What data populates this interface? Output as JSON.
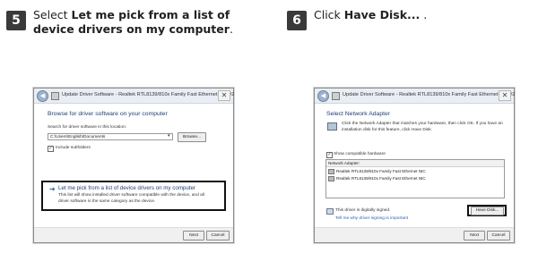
{
  "steps": [
    {
      "number": "5",
      "text_prefix": "Select ",
      "text_bold": "Let me pick from a list of device drivers on my computer",
      "text_suffix": "."
    },
    {
      "number": "6",
      "text_prefix": "Click ",
      "text_bold": "Have Disk...",
      "text_suffix": " ."
    }
  ],
  "dialog1": {
    "title": "Update Driver Software - Realtek RTL8139/810x Family Fast Ethernet NIC #2",
    "heading": "Browse for driver software on your computer",
    "search_label": "Search for driver software in this location:",
    "path_value": "C:\\Users\\English\\Documents",
    "browse_label": "Browse...",
    "include_subfolders": "Include subfolders",
    "option_title": "Let me pick from a list of device drivers on my computer",
    "option_desc_line1": "This list will show installed driver software compatible with the device, and all",
    "option_desc_line2": "driver software in the same category as the device.",
    "next_label": "Next",
    "cancel_label": "Cancel"
  },
  "dialog2": {
    "title": "Update Driver Software - Realtek RTL8139/810x Family Fast Ethernet NIC #2",
    "heading": "Select Network Adapter",
    "instruction_line1": "Click the Network Adapter that matches your hardware, then click OK. If you have an",
    "instruction_line2": "installation disk for this feature, click Have Disk.",
    "show_compatible": "Show compatible hardware",
    "list_header": "Network Adapter:",
    "list_items": [
      "Realtek RTL8139/810x Family Fast Ethernet NIC",
      "Realtek RTL8139/810x Family Fast Ethernet NIC"
    ],
    "signed_text": "This driver is digitally signed.",
    "signing_link": "Tell me why driver signing is important",
    "have_disk_label": "Have Disk...",
    "next_label": "Next",
    "cancel_label": "Cancel"
  }
}
